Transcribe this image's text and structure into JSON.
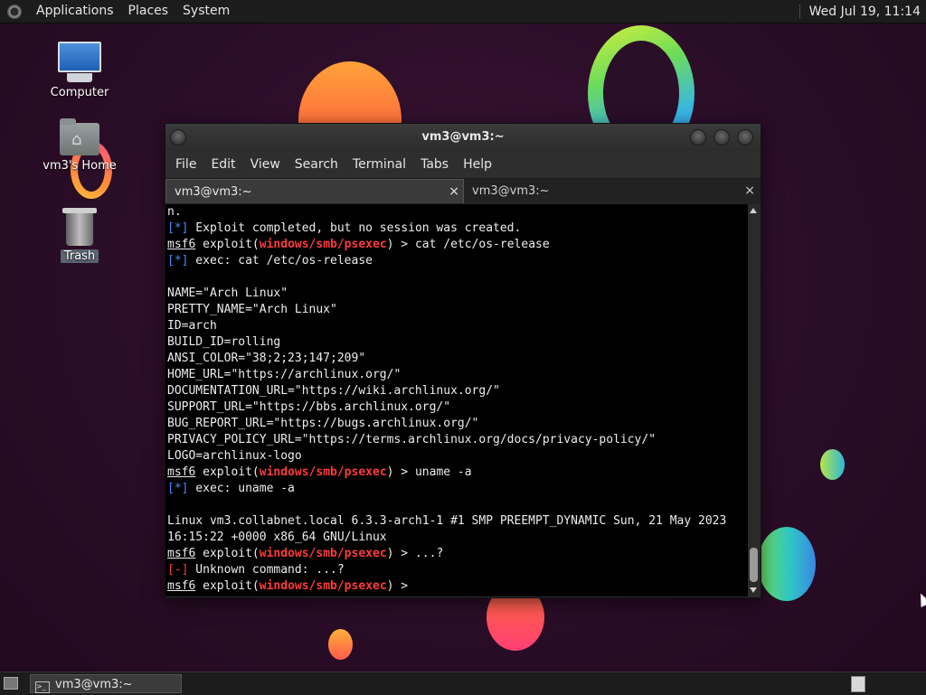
{
  "top_panel": {
    "menus": [
      "Applications",
      "Places",
      "System"
    ],
    "clock": "Wed Jul 19, 11:14"
  },
  "desktop_icons": [
    {
      "label": "Computer",
      "icon": "computer-icon"
    },
    {
      "label": "vm3's Home",
      "icon": "home-folder-icon"
    },
    {
      "label": "Trash",
      "icon": "trash-icon"
    }
  ],
  "window": {
    "title": "vm3@vm3:~",
    "menu": [
      "File",
      "Edit",
      "View",
      "Search",
      "Terminal",
      "Tabs",
      "Help"
    ],
    "tabs": [
      {
        "label": "vm3@vm3:~",
        "close": "×"
      },
      {
        "label": "vm3@vm3:~",
        "close": "×"
      }
    ]
  },
  "terminal": {
    "prompt": {
      "user": "msf6",
      "word": "exploit(",
      "module": "windows/smb/psexec",
      "close": ")",
      "arrow": " > "
    },
    "lines": [
      {
        "type": "plain",
        "text": "n."
      },
      {
        "type": "info",
        "marker": "[*]",
        "text": " Exploit completed, but no session was created."
      },
      {
        "type": "prompt",
        "cmd": "cat /etc/os-release"
      },
      {
        "type": "info",
        "marker": "[*]",
        "text": " exec: cat /etc/os-release"
      },
      {
        "type": "plain",
        "text": ""
      },
      {
        "type": "plain",
        "text": "NAME=\"Arch Linux\""
      },
      {
        "type": "plain",
        "text": "PRETTY_NAME=\"Arch Linux\""
      },
      {
        "type": "plain",
        "text": "ID=arch"
      },
      {
        "type": "plain",
        "text": "BUILD_ID=rolling"
      },
      {
        "type": "plain",
        "text": "ANSI_COLOR=\"38;2;23;147;209\""
      },
      {
        "type": "plain",
        "text": "HOME_URL=\"https://archlinux.org/\""
      },
      {
        "type": "plain",
        "text": "DOCUMENTATION_URL=\"https://wiki.archlinux.org/\""
      },
      {
        "type": "plain",
        "text": "SUPPORT_URL=\"https://bbs.archlinux.org/\""
      },
      {
        "type": "plain",
        "text": "BUG_REPORT_URL=\"https://bugs.archlinux.org/\""
      },
      {
        "type": "plain",
        "text": "PRIVACY_POLICY_URL=\"https://terms.archlinux.org/docs/privacy-policy/\""
      },
      {
        "type": "plain",
        "text": "LOGO=archlinux-logo"
      },
      {
        "type": "prompt",
        "cmd": "uname -a"
      },
      {
        "type": "info",
        "marker": "[*]",
        "text": " exec: uname -a"
      },
      {
        "type": "plain",
        "text": ""
      },
      {
        "type": "plain",
        "text": "Linux vm3.collabnet.local 6.3.3-arch1-1 #1 SMP PREEMPT_DYNAMIC Sun, 21 May 2023"
      },
      {
        "type": "plain",
        "text": "16:15:22 +0000 x86_64 GNU/Linux"
      },
      {
        "type": "prompt",
        "cmd": "...?"
      },
      {
        "type": "error",
        "marker": "[-]",
        "text": " Unknown command: ...?"
      },
      {
        "type": "prompt",
        "cmd": ""
      }
    ]
  },
  "taskbar": {
    "item_label": "vm3@vm3:~"
  },
  "colors": {
    "info_marker": "#4b8bff",
    "error_marker": "#ff3b3b",
    "module": "#ff3b3b"
  }
}
